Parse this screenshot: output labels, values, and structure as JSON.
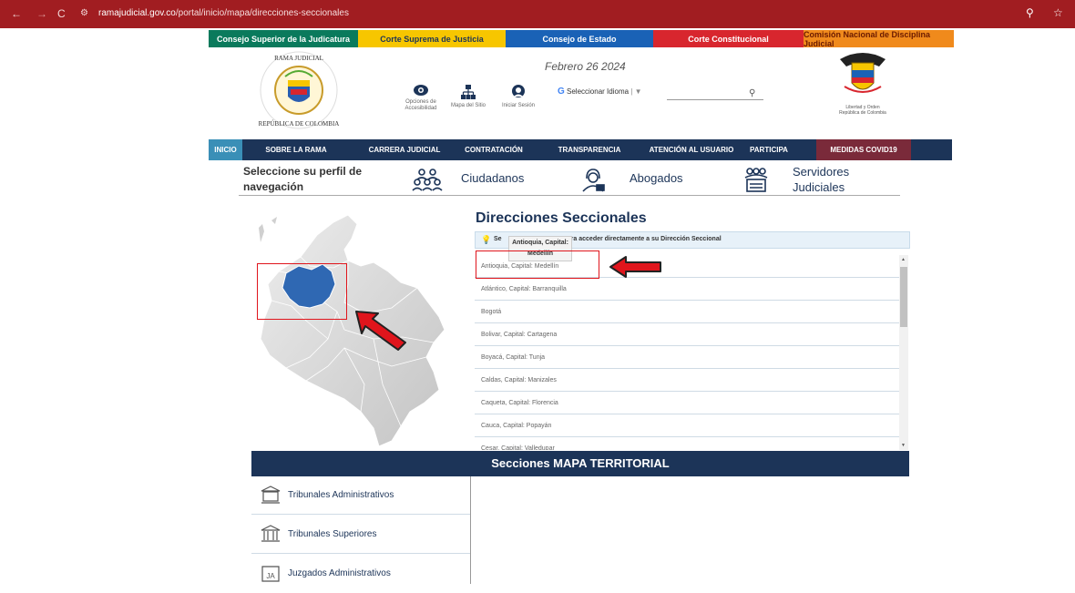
{
  "browser": {
    "url_domain": "ramajudicial.gov.co",
    "url_path": "/portal/inicio/mapa/direcciones-seccionales"
  },
  "entities": [
    {
      "label": "Consejo Superior de la Judicatura",
      "color": "#0a7a5c"
    },
    {
      "label": "Corte Suprema de Justicia",
      "color": "#f7c600"
    },
    {
      "label": "Consejo de Estado",
      "color": "#1a62b6"
    },
    {
      "label": "Corte Constitucional",
      "color": "#d8262e"
    },
    {
      "label": "Comisión Nacional de Disciplina Judicial",
      "color": "#f08a1c"
    }
  ],
  "header": {
    "date": "Febrero 26 2024",
    "tools": {
      "accessibility": "Opciones de Accesibilidad",
      "sitemap": "Mapa del Sitio",
      "login": "Iniciar Sesión"
    },
    "language": "Seleccionar Idioma",
    "shield_caption_1": "Libertad y Orden",
    "shield_caption_2": "República de Colombia"
  },
  "main_nav": [
    "INICIO",
    "SOBRE LA RAMA",
    "CARRERA JUDICIAL",
    "CONTRATACIÓN",
    "TRANSPARENCIA",
    "ATENCIÓN AL USUARIO",
    "PARTICIPA",
    "MEDIDAS COVID19"
  ],
  "perfil": {
    "title": "Seleccione su perfil de navegación",
    "ciudadanos": "Ciudadanos",
    "abogados": "Abogados",
    "servidores": "Servidores Judiciales"
  },
  "seccionales": {
    "title": "Direcciones Seccionales",
    "notice_start": "Se",
    "notice_end": "para acceder directamente a su Dirección Seccional",
    "tooltip_1": "Antioquia, Capital:",
    "tooltip_2": "Medellín",
    "items": [
      "Antioquia, Capital: Medellín",
      "Atlántico, Capital: Barranquilla",
      "Bogotá",
      "Bolivar, Capital: Cartagena",
      "Boyacá, Capital: Tunja",
      "Caldas, Capital: Manizales",
      "Caqueta, Capital: Florencia",
      "Cauca, Capital: Popayán",
      "Cesar, Capital: Valledupar"
    ]
  },
  "secciones": {
    "title": "Secciones MAPA TERRITORIAL",
    "items": [
      "Tribunales Administrativos",
      "Tribunales Superiores",
      "Juzgados Administrativos"
    ]
  }
}
